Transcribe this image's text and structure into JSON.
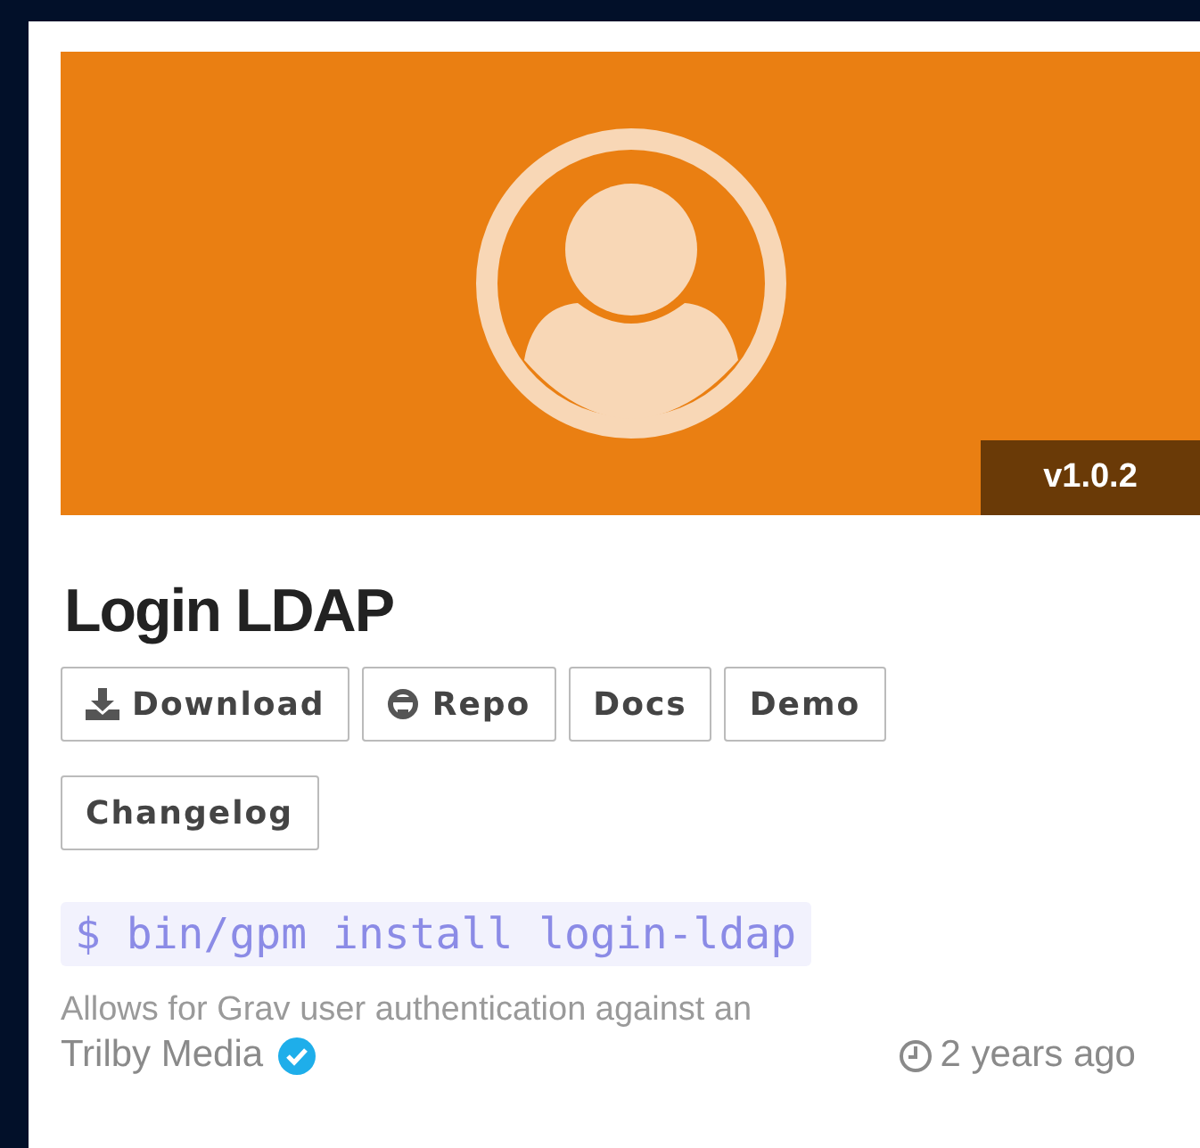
{
  "plugin": {
    "version": "v1.0.2",
    "title": "Login LDAP",
    "buttons": [
      {
        "label": "Download",
        "kind": "download"
      },
      {
        "label": "Repo",
        "kind": "repo"
      },
      {
        "label": "Docs",
        "kind": "plain"
      },
      {
        "label": "Demo",
        "kind": "plain"
      },
      {
        "label": "Changelog",
        "kind": "plain"
      }
    ],
    "command": "$ bin/gpm install login-ldap",
    "description": "Allows for Grav user authentication against an",
    "author": "Trilby Media",
    "verified": true,
    "updated": "2 years ago"
  }
}
